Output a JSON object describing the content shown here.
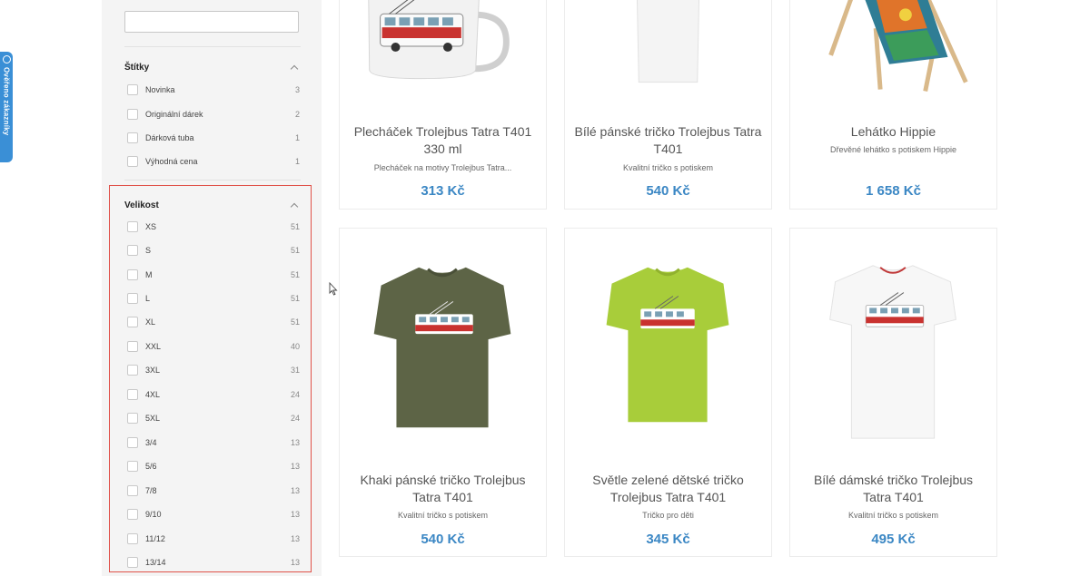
{
  "verify_tab": {
    "label": "Ověřeno zákazníky"
  },
  "filters": {
    "tags": {
      "title": "Štítky",
      "options": [
        {
          "label": "Novinka",
          "count": "3"
        },
        {
          "label": "Originální dárek",
          "count": "2"
        },
        {
          "label": "Dárková tuba",
          "count": "1"
        },
        {
          "label": "Výhodná cena",
          "count": "1"
        }
      ]
    },
    "size": {
      "title": "Velikost",
      "options": [
        {
          "label": "XS",
          "count": "51"
        },
        {
          "label": "S",
          "count": "51"
        },
        {
          "label": "M",
          "count": "51"
        },
        {
          "label": "L",
          "count": "51"
        },
        {
          "label": "XL",
          "count": "51"
        },
        {
          "label": "XXL",
          "count": "40"
        },
        {
          "label": "3XL",
          "count": "31"
        },
        {
          "label": "4XL",
          "count": "24"
        },
        {
          "label": "5XL",
          "count": "24"
        },
        {
          "label": "3/4",
          "count": "13"
        },
        {
          "label": "5/6",
          "count": "13"
        },
        {
          "label": "7/8",
          "count": "13"
        },
        {
          "label": "9/10",
          "count": "13"
        },
        {
          "label": "11/12",
          "count": "13"
        },
        {
          "label": "13/14",
          "count": "13"
        }
      ]
    }
  },
  "products": [
    {
      "name": "Plecháček Trolejbus Tatra T401 330 ml",
      "desc": "Plecháček na motivy Trolejbus Tatra...",
      "price": "313 Kč",
      "image": "mug"
    },
    {
      "name": "Bílé pánské tričko Trolejbus Tatra T401",
      "desc": "Kvalitní tričko s potiskem",
      "price": "540 Kč",
      "image": "white-shirt"
    },
    {
      "name": "Lehátko Hippie",
      "desc": "Dřevěné lehátko s potiskem Hippie",
      "price": "1 658 Kč",
      "image": "deck-chair"
    },
    {
      "name": "Khaki pánské tričko Trolejbus Tatra T401",
      "desc": "Kvalitní tričko s potiskem",
      "price": "540 Kč",
      "image": "khaki-shirt",
      "color": "#5d6446"
    },
    {
      "name": "Světle zelené dětské tričko Trolejbus Tatra T401",
      "desc": "Tričko pro děti",
      "price": "345 Kč",
      "image": "green-shirt",
      "color": "#a8cd3a"
    },
    {
      "name": "Bílé dámské tričko Trolejbus Tatra T401",
      "desc": "Kvalitní tričko s potiskem",
      "price": "495 Kč",
      "image": "white-ladies-shirt",
      "color": "#f7f7f7"
    }
  ],
  "colors": {
    "accent": "#3b87c4",
    "highlight": "#e0524a",
    "sidebar_bg": "#f4f4f4"
  }
}
